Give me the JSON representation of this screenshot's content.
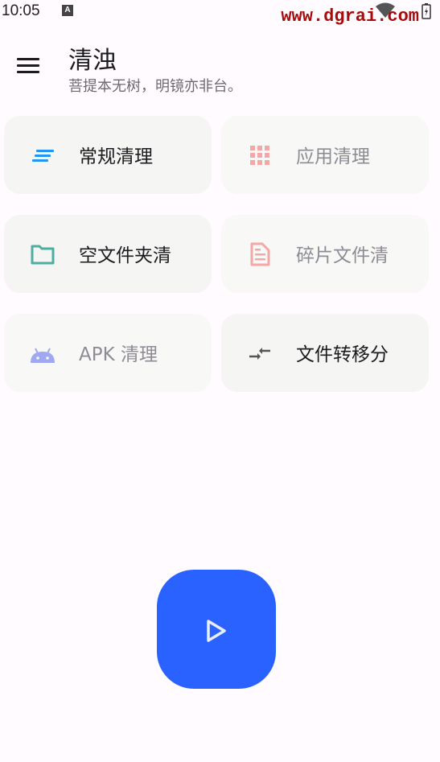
{
  "status_bar": {
    "time": "10:05",
    "notification_icon": "A",
    "watermark": "www.dgrai.com"
  },
  "header": {
    "menu_icon": "menu-icon",
    "title": "清浊",
    "subtitle": "菩提本无树，明镜亦非台。"
  },
  "cards": [
    {
      "label": "常规清理",
      "icon": "lines-icon",
      "color": "#2196f3",
      "enabled": true
    },
    {
      "label": "应用清理",
      "icon": "grid-icon",
      "color": "#f4a7a7",
      "enabled": false
    },
    {
      "label": "空文件夹清",
      "icon": "folder-icon",
      "color": "#4caf9f",
      "enabled": true
    },
    {
      "label": "碎片文件清",
      "icon": "document-icon",
      "color": "#f4a7a7",
      "enabled": false
    },
    {
      "label": "APK 清理",
      "icon": "android-icon",
      "color": "#9fa8f0",
      "enabled": false
    },
    {
      "label": "文件转移分",
      "icon": "transfer-icon",
      "color": "#555555",
      "enabled": true
    }
  ],
  "fab": {
    "icon": "play-icon",
    "color": "#2962ff"
  }
}
